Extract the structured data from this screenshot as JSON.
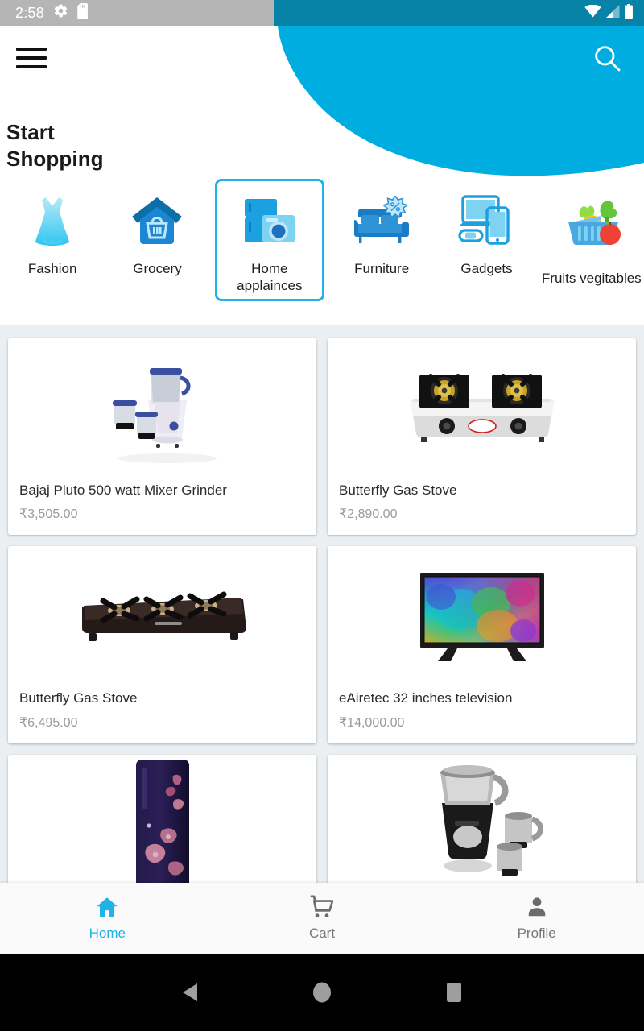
{
  "status_bar": {
    "time": "2:58",
    "left_icons": [
      "gear-icon",
      "sd-card-icon"
    ],
    "right_icons": [
      "wifi-icon",
      "cellular-signal-icon",
      "battery-icon"
    ],
    "left_bg_color": "#b5b5b5",
    "right_bg_color": "#0883a8"
  },
  "app_bar": {
    "menu_icon": "hamburger-menu-icon",
    "search_icon": "search-icon"
  },
  "hero": {
    "curve_color": "#00ade0"
  },
  "headline": {
    "line1": "Start",
    "line2": "Shopping"
  },
  "categories": {
    "selected_border_color": "#21b2e8",
    "items": [
      {
        "label": "Fashion",
        "icon": "dress-icon",
        "selected": false
      },
      {
        "label": "Grocery",
        "icon": "house-basket-icon",
        "selected": false
      },
      {
        "label": "Home applainces",
        "icon": "fridge-washer-icon",
        "selected": true
      },
      {
        "label": "Furniture",
        "icon": "sofa-discount-icon",
        "selected": false
      },
      {
        "label": "Gadgets",
        "icon": "laptop-phone-watch-icon",
        "selected": false
      },
      {
        "label": "Fruits vegitables",
        "icon": "fruit-basket-icon",
        "selected": false
      }
    ]
  },
  "products": [
    {
      "title": "Bajaj Pluto 500 watt Mixer Grinder",
      "price": "₹3,505.00",
      "image": "white-mixer-grinder-image"
    },
    {
      "title": "Butterfly Gas Stove",
      "price": "₹2,890.00",
      "image": "two-burner-steel-gas-stove-image"
    },
    {
      "title": "Butterfly Gas Stove",
      "price": "₹6,495.00",
      "image": "three-burner-black-glass-gas-stove-image"
    },
    {
      "title": "eAiretec 32 inches television",
      "price": "₹14,000.00",
      "image": "colorful-led-television-image"
    },
    {
      "title": "",
      "price": "",
      "image": "purple-floral-refrigerator-image"
    },
    {
      "title": "",
      "price": "",
      "image": "black-mixer-grinder-image"
    }
  ],
  "bottom_nav": {
    "active_color": "#21b2e8",
    "inactive_color": "#777777",
    "items": [
      {
        "label": "Home",
        "icon": "home-icon",
        "active": true
      },
      {
        "label": "Cart",
        "icon": "shopping-cart-icon",
        "active": false
      },
      {
        "label": "Profile",
        "icon": "person-icon",
        "active": false
      }
    ]
  },
  "system_nav": {
    "back": "back-triangle-icon",
    "home": "home-circle-icon",
    "recents": "recents-square-icon"
  }
}
